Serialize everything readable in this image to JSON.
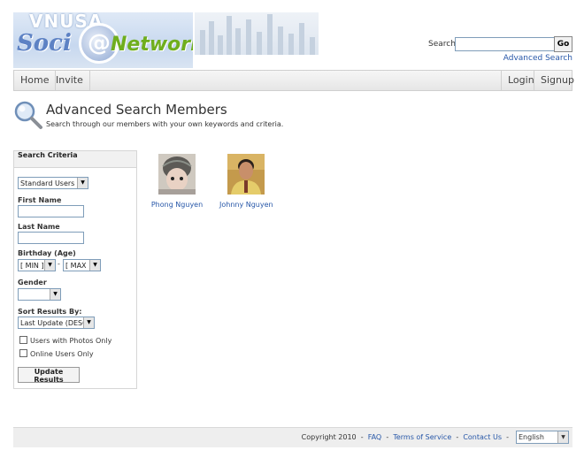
{
  "header": {
    "logo_top_text": "VNUSA",
    "logo_text_a": "Soci",
    "logo_text_at": "@",
    "logo_text_b": "Network",
    "search_label": "Search:",
    "search_value": "",
    "go_label": "Go",
    "advanced_search_label": "Advanced Search"
  },
  "nav": {
    "left": [
      "Home",
      "Invite"
    ],
    "right": [
      "Login",
      "Signup"
    ]
  },
  "page": {
    "title": "Advanced Search Members",
    "subtitle": "Search through our members with your own keywords and criteria."
  },
  "criteria": {
    "heading": "Search Criteria",
    "user_type": "Standard Users",
    "first_name_label": "First Name",
    "last_name_label": "Last Name",
    "birthday_label": "Birthday (Age)",
    "age_min": "[ MIN ]",
    "age_sep": "-",
    "age_max": "[ MAX ]",
    "gender_label": "Gender",
    "gender_value": "",
    "sort_label": "Sort Results By:",
    "sort_value": "Last Update (DESC)",
    "photos_only_label": "Users with Photos Only",
    "online_only_label": "Online Users Only",
    "update_button": "Update Results"
  },
  "members": [
    {
      "name": "Phong Nguyen"
    },
    {
      "name": "Johnny Nguyen"
    }
  ],
  "footer": {
    "copyright": "Copyright 2010",
    "sep": "-",
    "faq": "FAQ",
    "terms": "Terms of Service",
    "contact": "Contact Us",
    "language": "English"
  },
  "colors": {
    "link": "#2757a8",
    "brand_green": "#6fae1e",
    "brand_blue": "#5d82c4"
  }
}
